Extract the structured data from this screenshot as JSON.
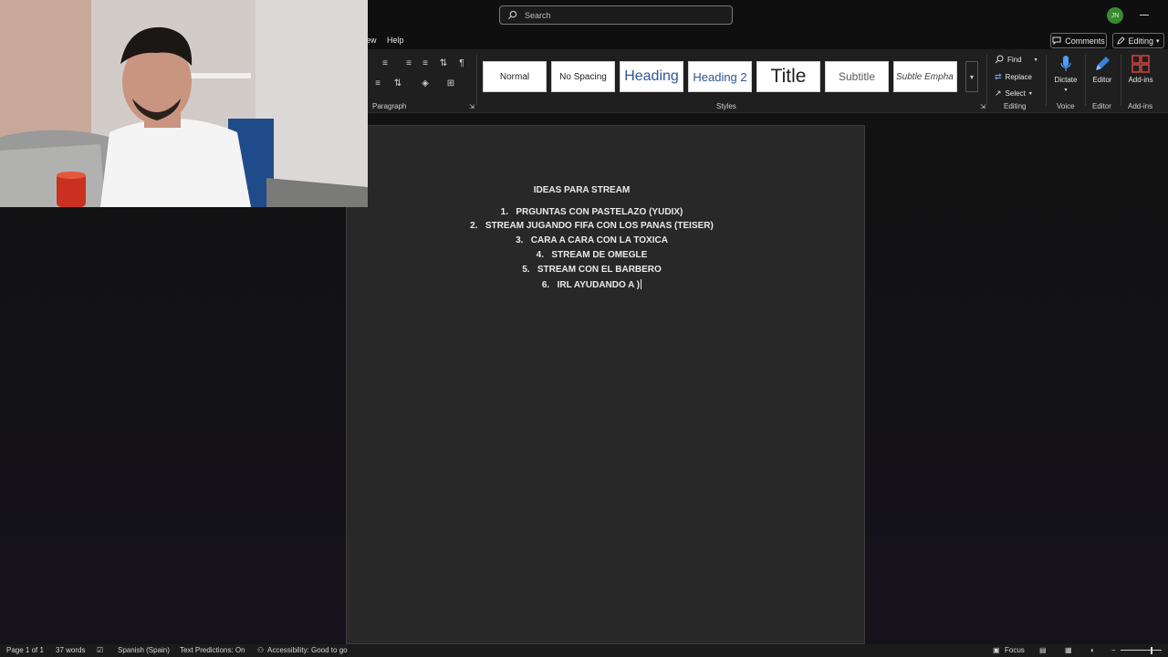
{
  "search": {
    "placeholder": "Search"
  },
  "account": {
    "initials": "JN"
  },
  "menu": {
    "view_partial": "ew",
    "help": "Help"
  },
  "actions": {
    "comments": "Comments",
    "editing": "Editing"
  },
  "ribbon": {
    "paragraph_label": "Paragraph",
    "styles_label": "Styles",
    "editing_label": "Editing",
    "voice_label": "Voice",
    "editor_label": "Editor",
    "addins_label": "Add-ins",
    "styles": [
      "Normal",
      "No Spacing",
      "Heading",
      "Heading 2",
      "Title",
      "Subtitle",
      "Subtle Empha"
    ],
    "find": "Find",
    "replace": "Replace",
    "select": "Select",
    "dictate": "Dictate",
    "editor": "Editor",
    "addins": "Add-ins"
  },
  "document": {
    "title": "IDEAS PARA STREAM",
    "items": [
      {
        "num": "1.",
        "text": "PRGUNTAS CON PASTELAZO (YUDIX)"
      },
      {
        "num": "2.",
        "text": "STREAM JUGANDO FIFA CON LOS PANAS (TEISER)"
      },
      {
        "num": "3.",
        "text": "CARA A CARA CON LA TOXICA"
      },
      {
        "num": "4.",
        "text": "STREAM DE OMEGLE"
      },
      {
        "num": "5.",
        "text": "STREAM CON EL BARBERO"
      },
      {
        "num": "6.",
        "text": "IRL AYUDANDO A )"
      }
    ]
  },
  "status": {
    "page": "Page 1 of 1",
    "words": "37 words",
    "language": "Spanish (Spain)",
    "predictions": "Text Predictions: On",
    "accessibility": "Accessibility: Good to go",
    "focus": "Focus"
  },
  "colors": {
    "accent_green": "#3a8a2f",
    "dictate_blue": "#4aa0ff",
    "addins_red": "#e0483e"
  }
}
